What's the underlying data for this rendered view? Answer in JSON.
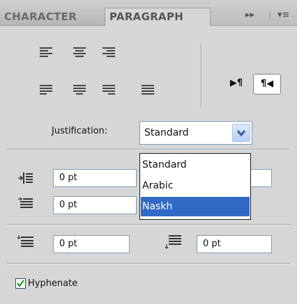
{
  "tabs": {
    "character": "CHARACTER",
    "paragraph": "PARAGRAPH"
  },
  "panel_controls": {
    "expand": "▸▸",
    "separator": "|",
    "menu": "▾≡"
  },
  "paragraph_direction": {
    "ltr": "▶¶",
    "rtl": "¶◀",
    "selected": "rtl"
  },
  "justification": {
    "label": "Justification:",
    "value": "Standard",
    "options": [
      "Standard",
      "Arabic",
      "Naskh"
    ],
    "highlighted": "Naskh"
  },
  "indents": {
    "left_value": "0 pt",
    "first_line_value": "0 pt"
  },
  "spacing": {
    "before_value": "0 pt",
    "after_value": "0 pt"
  },
  "hyphenate": {
    "label": "Hyphenate",
    "checked": true
  },
  "colors": {
    "accent": "#316ac5",
    "panel": "#d6d6d6"
  }
}
